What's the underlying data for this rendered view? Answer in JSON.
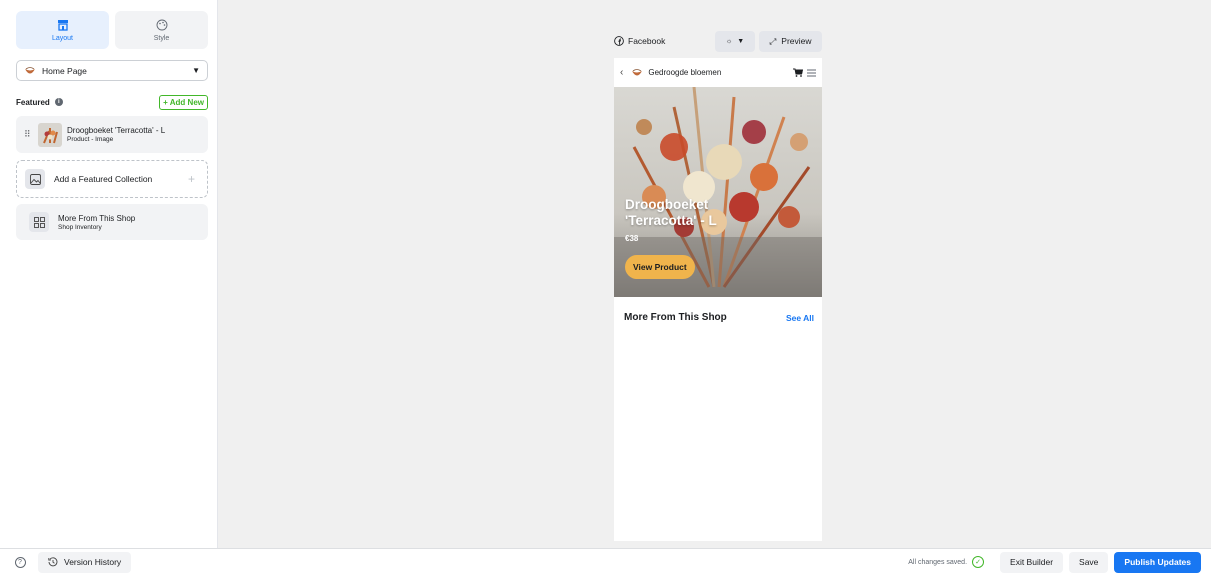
{
  "sidebar": {
    "tabs": [
      {
        "label": "Layout",
        "icon": "storefront-icon",
        "active": true
      },
      {
        "label": "Style",
        "icon": "palette-icon",
        "active": false
      }
    ],
    "page_select": {
      "value": "Home Page",
      "icon": "shop-logo-icon"
    },
    "featured": {
      "title": "Featured",
      "add_new": "+ Add New"
    },
    "cards": {
      "product": {
        "title": "Droogboeket 'Terracotta' - L",
        "subtitle": "Product - Image"
      },
      "collection": {
        "title": "Add a Featured Collection"
      },
      "more": {
        "title": "More From This Shop",
        "subtitle": "Shop Inventory"
      }
    }
  },
  "preview": {
    "platform_label": "Facebook",
    "preview_button": "Preview",
    "shop_name": "Gedroogde bloemen",
    "hero": {
      "title": "Droogboeket 'Terracotta' - L",
      "price": "€38",
      "button": "View Product"
    },
    "more_section": {
      "title": "More From This Shop",
      "see_all": "See All"
    }
  },
  "footer": {
    "version_history": "Version History",
    "status": "All changes saved.",
    "exit": "Exit Builder",
    "save": "Save",
    "publish": "Publish Updates"
  },
  "colors": {
    "accent": "#1877f2",
    "success": "#42b72a",
    "cta": "#f0b44c"
  }
}
